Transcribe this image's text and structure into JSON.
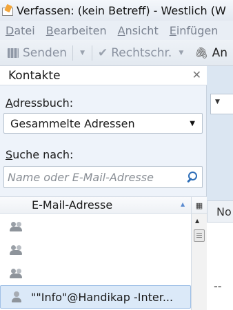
{
  "window": {
    "title": "Verfassen: (kein Betreff) - Westlich (W"
  },
  "menubar": {
    "items": [
      {
        "accel": "D",
        "rest": "atei"
      },
      {
        "accel": "B",
        "rest": "earbeiten"
      },
      {
        "accel": "A",
        "rest": "nsicht"
      },
      {
        "accel": "E",
        "rest": "infügen"
      }
    ]
  },
  "toolbar": {
    "send_label": "Senden",
    "spell_label": "Rechtschr.",
    "attach_label": "An"
  },
  "sidebar": {
    "title": "Kontakte",
    "addressbook_label": {
      "accel": "A",
      "rest": "dressbuch:"
    },
    "addressbook_value": "Gesammelte Adressen",
    "search_label": {
      "accel": "S",
      "rest": "uche nach:"
    },
    "search_placeholder": "Name oder E-Mail-Adresse",
    "column_header": "E-Mail-Adresse",
    "rows": [
      {
        "icon": "group-icon",
        "text": ""
      },
      {
        "icon": "group-icon",
        "text": ""
      },
      {
        "icon": "group-icon",
        "text": ""
      },
      {
        "icon": "person-icon",
        "text": "\"\"Info\"@Handikap -Inter..."
      }
    ]
  },
  "compose": {
    "format_label": "No",
    "signature_text": "--"
  },
  "colors": {
    "sidebar_bg": "#eef3fa",
    "selected_row_bg": "#dbe9f8",
    "search_icon": "#2f6fb8"
  }
}
